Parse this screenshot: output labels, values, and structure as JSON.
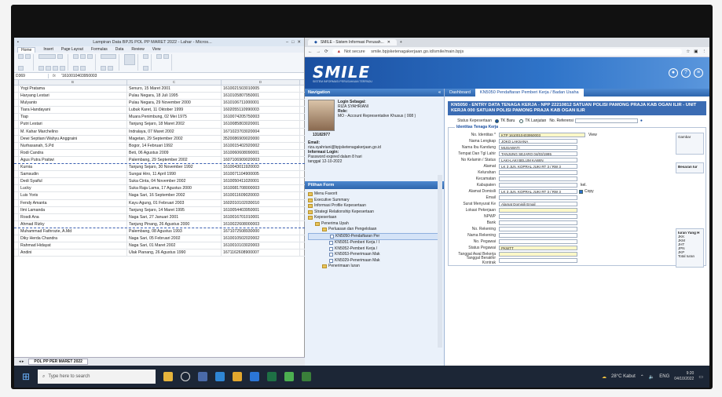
{
  "excel": {
    "title": "Lampiran Data BPJS POL PP MARET 2022 - Lahar - Micros...",
    "tabs": [
      "Home",
      "Insert",
      "Page Layout",
      "Formulas",
      "Data",
      "Review",
      "View"
    ],
    "namebox": "D369",
    "formula_value": "'1610010403950003",
    "columns": [
      "B",
      "C",
      "D"
    ],
    "rows": [
      [
        "Yogi Pratama",
        "Senuro, 15 Maret 2001",
        "1610021503010005"
      ],
      [
        "Haryang Lestari",
        "Pulau Negara, 18 Juli 1995",
        "1610105807950001"
      ],
      [
        "Mulyanto",
        "Pulau Negara, 29 November 2000",
        "1610106711000001"
      ],
      [
        "Tiara Handayani",
        "Lubuk Karet, 11 Oktober 1999",
        "1602055110990003"
      ],
      [
        "Tiap",
        "Muara Penimbung, 02 Mei 1975",
        "1610074205750003"
      ],
      [
        "Putri Lestari",
        "Tanjung Sejaro, 18 Maret 2002",
        "1610085803020001"
      ],
      [
        "M. Kahar Marchelino",
        "Indralaya, 07 Maret 2002",
        "1671023703020004"
      ],
      [
        "Dewi Septiani Wahyu Anggraini",
        "Magetan, 29 September 2002",
        "3520086909020000"
      ],
      [
        "Nurhasanah, S.Pd",
        "Bogor, 14 Februari 1992",
        "1610015402920002"
      ],
      [
        "Rodi Candra",
        "Beti, 06 Agustus 2009",
        "1610060608090001"
      ],
      [
        "Agus Putra Pratiwi",
        "Palembang, 29 September 2002",
        "1607106909020003"
      ],
      [
        "Kurnia",
        "Tanjung Sejaro, 30 November 1992",
        "1610043011920003"
      ],
      [
        "Samsudin",
        "Sungai Hiro, 11 April 1990",
        "1610071104900005"
      ],
      [
        "Dedi Syaiful",
        "Suka Cinta, 04 November 2002",
        "1610050411020001"
      ],
      [
        "Lucky",
        "Suka Raja Lama, 17 Agustus 2000",
        "1610081708000003"
      ],
      [
        "Luis Yoris",
        "Naga Sari, 16 September 2002",
        "1610011609020003"
      ],
      [
        "Fendy Amanta",
        "Kayu Agung, 01 Februari 2003",
        "1602010102030010"
      ],
      [
        "Ilmi Lamanda",
        "Tanjung Sejaro, 14 Maret 1995",
        "1610054403950001"
      ],
      [
        "Rosdi Ana",
        "Naga Sari, 27 Januari 2001",
        "1610016701010001"
      ],
      [
        "Ahmad Rizky",
        "Tanjung Pinang, 26 Agustus 2000",
        "1610022608000003"
      ],
      [
        "Muhammad Fathrozie, A.Md",
        "Palembang, 08 Agustus 1993",
        "1671072508930000"
      ],
      [
        "Diky Herda Chandra",
        "Naga Sari, 05 Februari 2002",
        "1610010502020002"
      ],
      [
        "Rahmad Hidayat",
        "Naga Sari, 01 Maret 2002",
        "1610010103020003"
      ],
      [
        "Andini",
        "Ulak Pianang, 26 Agustus 1990",
        "1671162608900007"
      ]
    ],
    "sheet_name": "POL PP PER MARET 2022"
  },
  "browser": {
    "tab_title": "SMILE - Sistem Informasi Perusah...",
    "url_warning": "Not secure",
    "url": "smile.bpjsketenagakerjaan.go.id/smile/main.bpjs"
  },
  "smile": {
    "logo": "SMILE",
    "logo_sub": "SISTEM INFORMASI PERUSAHAAN TERPADU",
    "nav_title": "Navigation",
    "login_label": "Login Sebagai:",
    "login_name": "RIZA SYAHRIANI",
    "role_label": "Role:",
    "role_value": "MO - Account Representative Khusus ( 008 )",
    "user_id": "13182977",
    "email_label": "Email:",
    "email_value": "riza.syahriani@bpjsketenagakerjaan.go.id",
    "info_label": "Informasi Login:",
    "info_value": "Password expired dalam 8 hari",
    "info_date": "tanggal 12-10-2022",
    "form_panel": "Pilihan Form",
    "tree": [
      {
        "label": "Menu Favorit",
        "level": 0
      },
      {
        "label": "Executive Summary",
        "level": 0
      },
      {
        "label": "Informasi Profile Kepesertaan",
        "level": 0
      },
      {
        "label": "Strategi Relationship Kepesertaan",
        "level": 0
      },
      {
        "label": "Kepesertaan",
        "level": 0
      },
      {
        "label": "Penerima Upah",
        "level": 1
      },
      {
        "label": "Perluasan dan Pengelolaan",
        "level": 2
      },
      {
        "label": "KN5050-Pendaftaran Per",
        "level": 3,
        "selected": true
      },
      {
        "label": "KN5051-Pemberi Kerja / I",
        "level": 3
      },
      {
        "label": "KN5052-Pemberi Kerja /",
        "level": 3
      },
      {
        "label": "KN5053-Penerimaan Mak",
        "level": 3
      },
      {
        "label": "KN5029-Penerimaan Mak",
        "level": 3
      },
      {
        "label": "Penerimaan Iuran",
        "level": 2
      }
    ],
    "tab_dashboard": "Dashboard",
    "tab_active": "KN5050 Pendaftaran Pemberi Kerja / Badan Usaha",
    "form_title": "KN5050 - ENTRY DATA TENAGA KERJA - NPP 22210812 SATUAN POLISI PAMONG PRAJA KAB OGAN ILIR - UNIT KERJA 000 SATUAN POLISI PAMONG PRAJA KAB OGAN ILIR",
    "status_label": "Status Kepesertaan",
    "status_opt1": "TK Baru",
    "status_opt2": "TK Lanjutan",
    "no_ref_label": "No. Referensi",
    "section_title": "Identitas Tenaga Kerja",
    "fields": [
      {
        "label": "No. Identitas *",
        "value": "KTP  1610010403950003",
        "yellow": true
      },
      {
        "label": "Nama Lengkap",
        "value": "JOKO LAKSANA"
      },
      {
        "label": "Nama Ibu Kandung",
        "value": "MUSAWATI"
      },
      {
        "label": "Tempat Dan Tgl Lahir",
        "value": "TANJUNG SEJARO   04/03/1995"
      },
      {
        "label": "No Kelamin / Status",
        "value": "LAKI-LAKI   BELUM KAWIN"
      },
      {
        "label": "Alamat",
        "value": "LK 3 JLN. KOPRAL JUKI RT 3 / RW 3"
      },
      {
        "label": "Kelurahan",
        "value": ""
      },
      {
        "label": "Kecamatan",
        "value": ""
      },
      {
        "label": "Kabupaten",
        "value": ""
      },
      {
        "label": "Alamat Domisili",
        "value": "LK 3 JLN. KOPRAL JUKI RT 3 / RW 3"
      },
      {
        "label": "Email",
        "value": ""
      },
      {
        "label": "Surat Menyurat Ke",
        "value": "Alamat Domisili   Email"
      },
      {
        "label": "Lokasi Pekerjaan",
        "value": "",
        "yellow": true
      },
      {
        "label": "NPWP",
        "value": ""
      },
      {
        "label": "Bank",
        "value": ""
      },
      {
        "label": "No. Rekening",
        "value": ""
      },
      {
        "label": "Nama Rekening",
        "value": ""
      },
      {
        "label": "No. Pegawai",
        "value": ""
      },
      {
        "label": "Status Pegawai",
        "value": "PKWTT",
        "yellow": true
      },
      {
        "label": "Tanggal Awal Bekerja",
        "value": "",
        "yellow": true
      },
      {
        "label": "Tanggal Berakhir Kontrak",
        "value": ""
      }
    ],
    "foto_label": "Gambar",
    "view_label": "View",
    "kel_label": "kel.",
    "copy_label": "Copy",
    "right_peek_title": "Besaran Iur",
    "right_peek2_title": "Iuran Yang H",
    "right_peek2_rows": [
      "JKK",
      "JKM",
      "JHT",
      "JPN",
      "JKP",
      "Total Iuran"
    ]
  },
  "taskbar": {
    "search_placeholder": "Type here to search",
    "weather": "28°C Kabut",
    "lang": "ENG",
    "time": "9:20",
    "date": "04/10/2022"
  },
  "colors": {
    "smile_blue": "#1a4fa0",
    "yellow_field": "#fff8c8",
    "taskbar": "#1c2636"
  }
}
